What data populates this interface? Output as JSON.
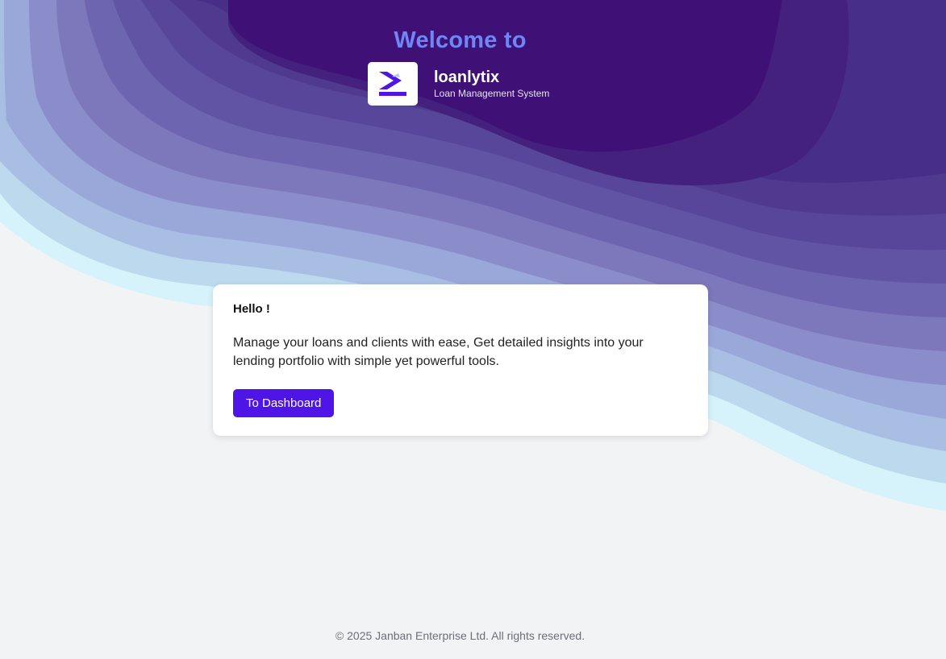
{
  "hero": {
    "title": "Welcome to",
    "brand_name": "loanlytix",
    "brand_subtitle": "Loan Management System",
    "logo_icon": "loanlytix-logo-icon"
  },
  "card": {
    "greeting": "Hello !",
    "body": "Manage your loans and clients with ease, Get detailed insights into your lending portfolio with simple yet powerful tools.",
    "button_label": "To Dashboard"
  },
  "footer": {
    "copyright": "© 2025 Janban Enterprise Ltd. All rights reserved."
  },
  "colors": {
    "background": "#f2f3f5",
    "accent": "#4f14e6",
    "title": "#6f86f5",
    "wave_deep": "#3f1177",
    "wave_light": "#d6f3fb"
  }
}
